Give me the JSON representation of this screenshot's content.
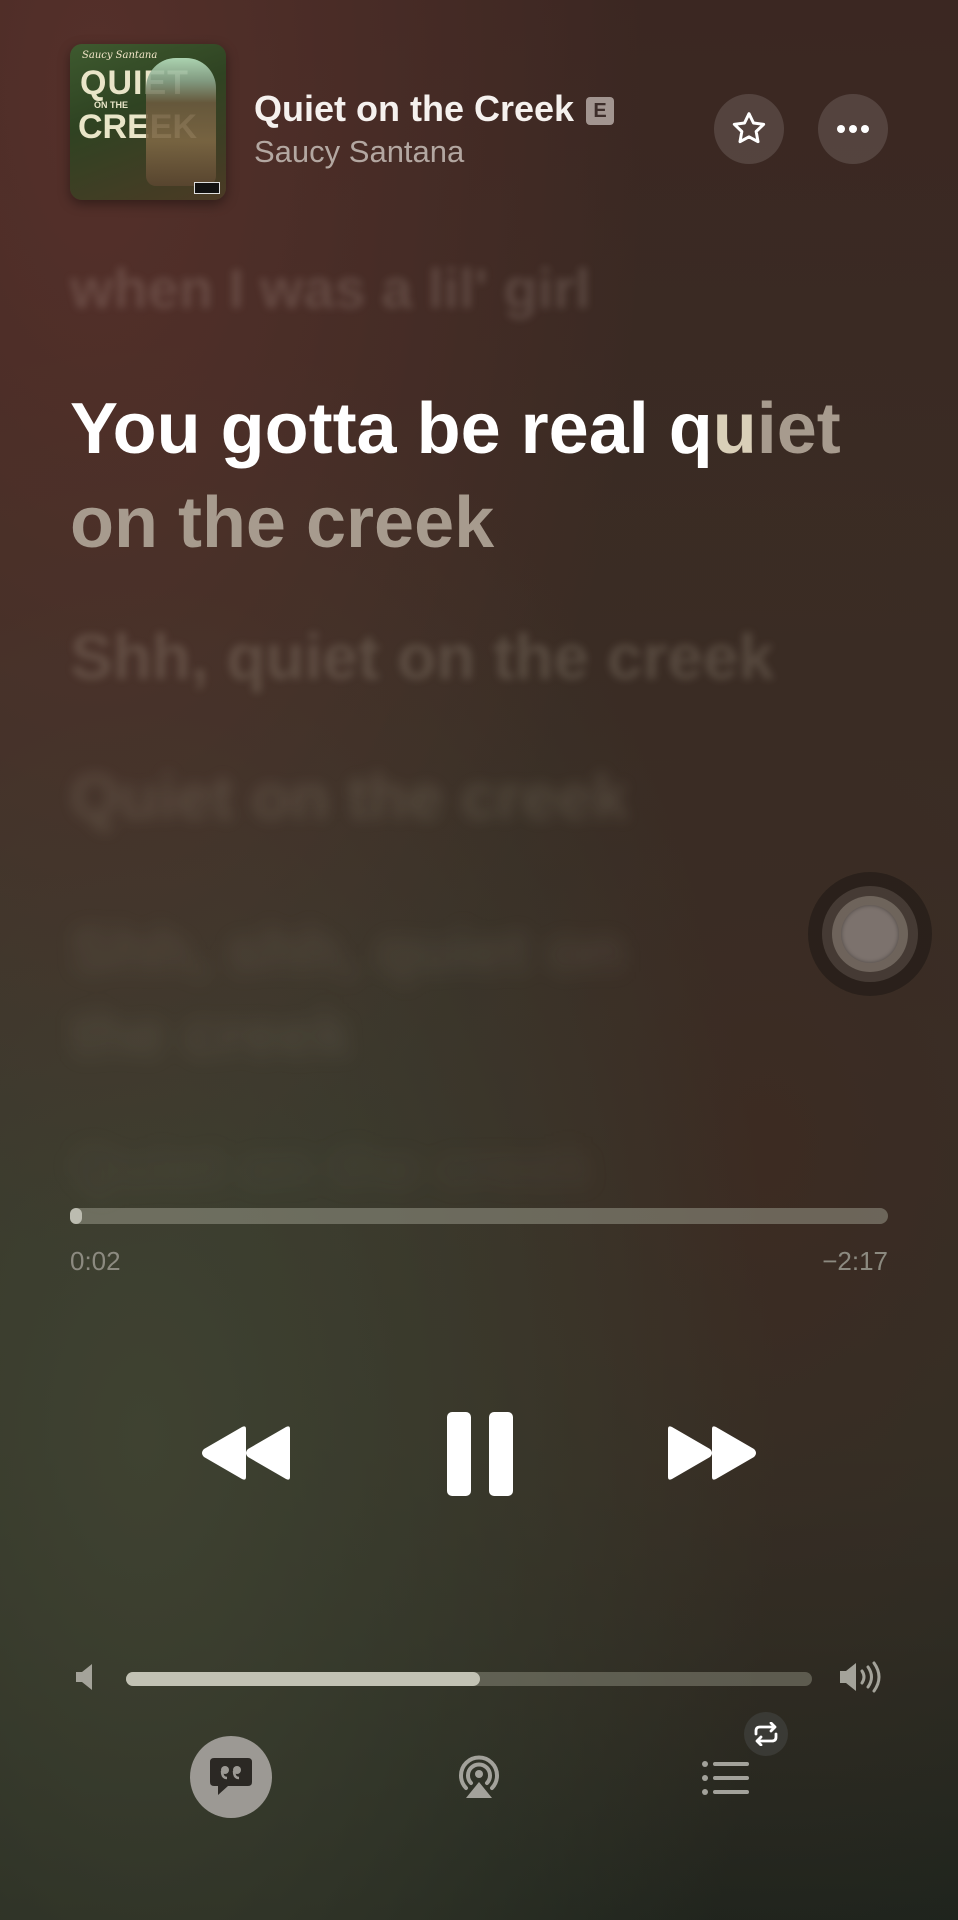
{
  "now_playing": {
    "title": "Quiet on the Creek",
    "explicit_badge": "E",
    "artist": "Saucy Santana",
    "artwork": {
      "signature": "Saucy Santana",
      "line1": "QUIET",
      "line2": "ON THE",
      "line3": "CREEK"
    }
  },
  "header": {
    "favorite_icon": "star-icon",
    "more_icon": "ellipsis-icon"
  },
  "lyrics": {
    "previous": "when I was a lil' girl",
    "current_sung": "You gotta be real q",
    "current_partial": "u",
    "current_rest": "iet",
    "current_line2": "on the creek",
    "upcoming": [
      "Shh, quiet on the creek",
      "Quiet on the creek",
      "Shh, shh, quiet on the creek",
      "Quiet on the creek"
    ]
  },
  "playback": {
    "elapsed": "0:02",
    "remaining": "−2:17",
    "progress_fraction": 0.015,
    "state": "playing"
  },
  "volume": {
    "level_fraction": 0.516
  },
  "bottom_bar": {
    "lyrics_icon": "quote-bubble-icon",
    "airplay_icon": "airplay-icon",
    "queue_icon": "list-icon",
    "repeat_icon": "repeat-icon"
  },
  "colors": {
    "accent_text": "#ffffff",
    "secondary_text": "#b3a7a1"
  }
}
